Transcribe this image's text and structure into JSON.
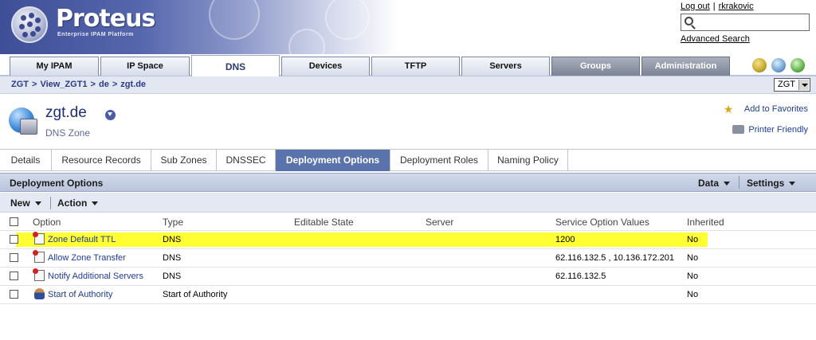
{
  "header": {
    "brand": "Proteus",
    "tagline": "Enterprise IPAM Platform",
    "logout": "Log out",
    "username": "rkrakovic",
    "search_value": "",
    "advanced_search": "Advanced Search"
  },
  "tabs": [
    {
      "label": "My IPAM"
    },
    {
      "label": "IP Space"
    },
    {
      "label": "DNS"
    },
    {
      "label": "Devices"
    },
    {
      "label": "TFTP"
    },
    {
      "label": "Servers"
    },
    {
      "label": "Groups"
    },
    {
      "label": "Administration"
    }
  ],
  "breadcrumb": [
    "ZGT",
    "View_ZGT1",
    "de",
    "zgt.de"
  ],
  "breadcrumb_sep": ">",
  "config_select": "ZGT",
  "object": {
    "title": "zgt.de",
    "subtitle": "DNS Zone",
    "add_favorites": "Add to Favorites",
    "printer_friendly": "Printer Friendly"
  },
  "subtabs": [
    {
      "label": "Details"
    },
    {
      "label": "Resource Records"
    },
    {
      "label": "Sub Zones"
    },
    {
      "label": "DNSSEC"
    },
    {
      "label": "Deployment Options"
    },
    {
      "label": "Deployment Roles"
    },
    {
      "label": "Naming Policy"
    }
  ],
  "section": {
    "title": "Deployment Options",
    "data_menu": "Data",
    "settings_menu": "Settings",
    "new_button": "New",
    "action_button": "Action"
  },
  "table": {
    "columns": [
      "Option",
      "Type",
      "Editable State",
      "Server",
      "Service Option Values",
      "Inherited"
    ],
    "rows": [
      {
        "option": "Zone Default TTL",
        "type": "DNS",
        "editable": "",
        "server": "",
        "values": "1200",
        "inherited": "No"
      },
      {
        "option": "Allow Zone Transfer",
        "type": "DNS",
        "editable": "",
        "server": "",
        "values": "62.116.132.5 , 10.136.172.201",
        "inherited": "No"
      },
      {
        "option": "Notify Additional Servers",
        "type": "DNS",
        "editable": "",
        "server": "",
        "values": "62.116.132.5",
        "inherited": "No"
      },
      {
        "option": "Start of Authority",
        "type": "Start of Authority",
        "editable": "",
        "server": "",
        "values": "",
        "inherited": "No"
      }
    ]
  }
}
